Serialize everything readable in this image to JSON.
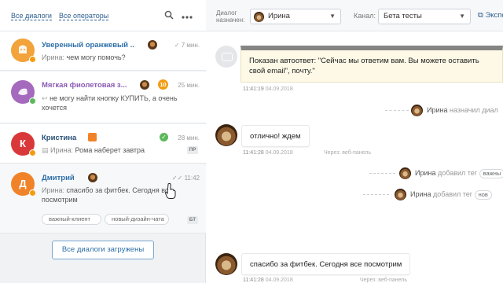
{
  "filters": {
    "all_dialogs": "Все диалоги",
    "all_operators": "Все операторы"
  },
  "icons": {
    "search": "search-icon",
    "more": "more-icon"
  },
  "chats": [
    {
      "name": "Уверенный оранжевый ...",
      "time": "7 мин.",
      "who": "Ирина:",
      "message": "чем могу помочь?",
      "avatar_color": "#f2a33a",
      "status_color": "#f39c12"
    },
    {
      "name": "Мягкая фиолетовая з...",
      "badge": "10",
      "time": "25 мин.",
      "message": "не могу найти кнопку КУПИТЬ, а очень хочется",
      "avatar_color": "#a569bd",
      "status_color": "#5cb85c"
    },
    {
      "name": "Кристина",
      "time": "28 мин.",
      "who": "Ирина:",
      "message": "Рома наберет завтра",
      "channel": "ПР",
      "avatar_letter": "К",
      "avatar_color": "#d9383a",
      "status_color": "#f39c12"
    },
    {
      "name": "Дмитрий",
      "time": "11:42",
      "who": "Ирина:",
      "message": "спасибо за фитбек. Сегодня все посмотрим",
      "tags": [
        "важный-клиент",
        "новый-дизайн-чата"
      ],
      "channel": "БТ",
      "avatar_letter": "Д",
      "avatar_color": "#f0832a",
      "status_color": "#f39c12"
    }
  ],
  "loaded_button": "Все диалоги загружены",
  "header": {
    "assigned_label_line1": "Диалог",
    "assigned_label_line2": "назначен:",
    "assigned_value": "Ирина",
    "channel_label": "Канал:",
    "channel_value": "Бета тесты",
    "export_label": "Экспо"
  },
  "messages": {
    "autoreply": "Показан автоответ: \"Сейчас мы ответим вам. Вы можете оставить свой email\", почту.\"",
    "autoreply_time": "11:41:19",
    "autoreply_date": "04.09.2018",
    "event1_who": "Ирина",
    "event1_action": "назначил диал",
    "msg1_text": "отлично! ждем",
    "msg1_time": "11:41:28",
    "msg1_date": "04.09.2018",
    "msg1_via": "Через: веб-панель",
    "event2_who": "Ирина",
    "event2_action": "добавил тег",
    "event2_tag": "важны",
    "event3_who": "Ирина",
    "event3_action": "добавил тег",
    "event3_tag": "нов",
    "msg2_text": "спасибо за фитбек. Сегодня все посмотрим",
    "msg2_time": "11:41:28",
    "msg2_date": "04.09.2018",
    "msg2_via": "Через: веб-панель"
  },
  "colors": {
    "link": "#2d5e8f",
    "accent_orange": "#f39c12",
    "online_green": "#5cb85c"
  }
}
